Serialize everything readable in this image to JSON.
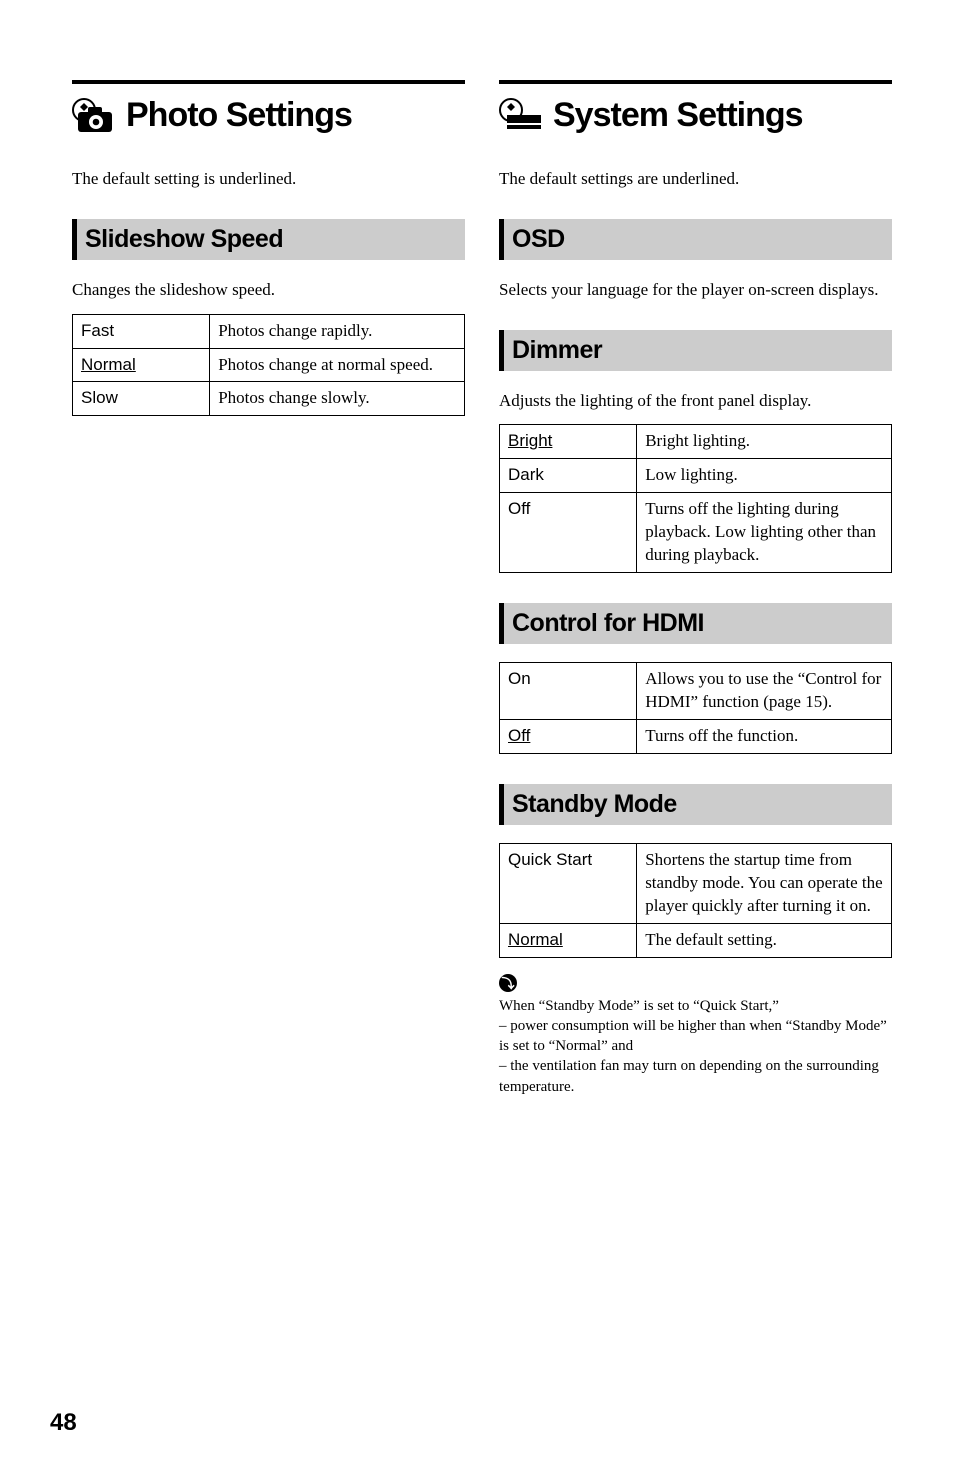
{
  "left": {
    "headline": "Photo Settings",
    "intro": "The default setting is underlined.",
    "slideshow": {
      "heading": "Slideshow Speed",
      "desc": "Changes the slideshow speed.",
      "rows": [
        {
          "key": "Fast",
          "val": "Photos change rapidly."
        },
        {
          "key": "Normal",
          "val": "Photos change at normal speed.",
          "underline": true
        },
        {
          "key": "Slow",
          "val": "Photos change slowly."
        }
      ]
    }
  },
  "right": {
    "headline": "System Settings",
    "intro": "The default settings are underlined.",
    "osd": {
      "heading": "OSD",
      "desc": "Selects your language for the player on-screen displays."
    },
    "dimmer": {
      "heading": "Dimmer",
      "desc": "Adjusts the lighting of the front panel display.",
      "rows": [
        {
          "key": "Bright",
          "val": "Bright lighting.",
          "underline": true
        },
        {
          "key": "Dark",
          "val": "Low lighting."
        },
        {
          "key": "Off",
          "val": "Turns off the lighting during playback. Low lighting other than during playback."
        }
      ]
    },
    "hdmi": {
      "heading": "Control for HDMI",
      "rows": [
        {
          "key": "On",
          "val": "Allows you to use the “Control for HDMI” function (page 15)."
        },
        {
          "key": "Off",
          "val": "Turns off the function.",
          "underline": true
        }
      ]
    },
    "standby": {
      "heading": "Standby Mode",
      "rows": [
        {
          "key": "Quick Start",
          "val": "Shortens the startup time from standby mode. You can operate the player quickly after turning it on."
        },
        {
          "key": "Normal",
          "val": "The default setting.",
          "underline": true
        }
      ],
      "note_glyph": "⤵",
      "note_intro": "When “Standby Mode” is set to “Quick Start,”",
      "note_b1": "– power consumption will be higher than when “Standby Mode” is set to “Normal” and",
      "note_b2": "– the ventilation fan may turn on depending on the surrounding temperature."
    }
  },
  "page": "48"
}
